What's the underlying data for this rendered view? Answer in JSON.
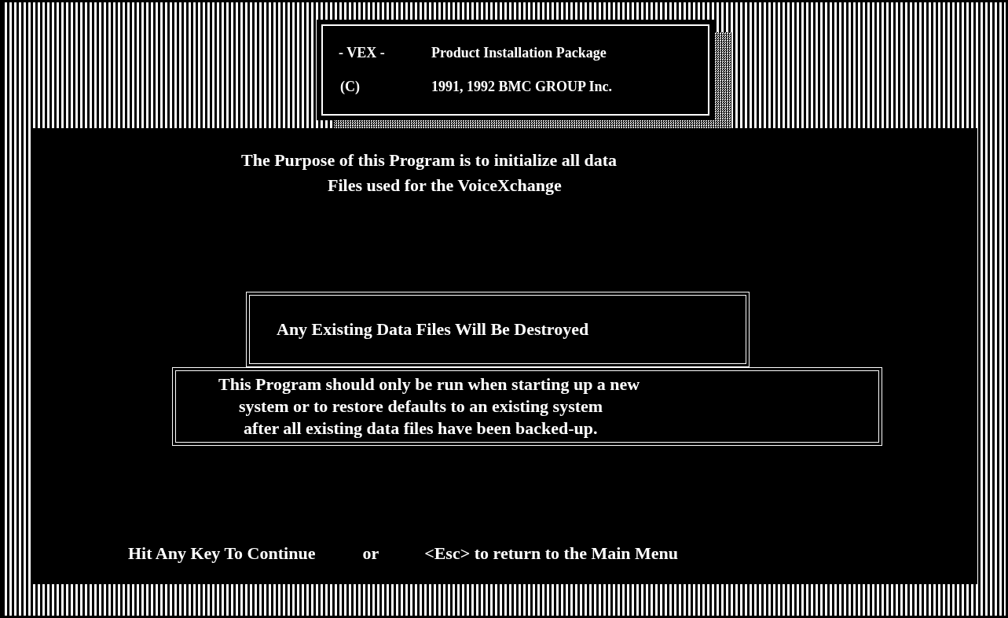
{
  "header": {
    "product_tag": "- VEX -",
    "title": "Product Installation Package",
    "copyright_mark": "(C)",
    "copyright": "1991, 1992 BMC GROUP Inc."
  },
  "purpose": [
    "The Purpose of this Program is to initialize all data",
    "Files used for the VoiceXchange"
  ],
  "warning": "Any Existing Data Files Will Be Destroyed",
  "note": [
    "This Program should only be run when starting up a new",
    "system or to restore defaults to an existing system",
    "after all existing data files have been backed-up."
  ],
  "footer": {
    "continue": "Hit Any Key To Continue",
    "or": "or",
    "escape": "<Esc> to return to the Main Menu"
  }
}
